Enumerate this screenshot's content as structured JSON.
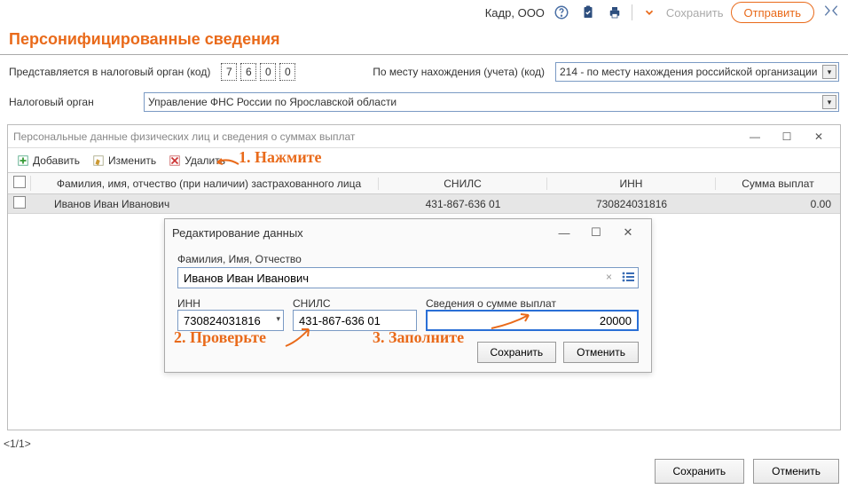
{
  "top": {
    "company": "Кадр, ООО",
    "save": "Сохранить",
    "send": "Отправить"
  },
  "title": "Персонифицированные сведения",
  "row1": {
    "label1": "Представляется в налоговый орган (код)",
    "digits": [
      "7",
      "6",
      "0",
      "0"
    ],
    "label2": "По месту нахождения (учета) (код)",
    "loc_value": "214 - по месту нахождения российской организации"
  },
  "row2": {
    "label": "Налоговый орган",
    "value": "Управление ФНС России по Ярославской области"
  },
  "inner": {
    "title": "Персональные данные физических лиц и сведения о суммах выплат",
    "toolbar": {
      "add": "Добавить",
      "edit": "Изменить",
      "delete": "Удалить"
    },
    "annot1": "1. Нажмите",
    "columns": {
      "fio": "Фамилия, имя, отчество (при наличии) застрахованного лица",
      "snils": "СНИЛС",
      "inn": "ИНН",
      "sum": "Сумма выплат"
    },
    "rows": [
      {
        "fio": "Иванов Иван Иванович",
        "snils": "431-867-636 01",
        "inn": "730824031816",
        "sum": "0.00"
      }
    ]
  },
  "dialog": {
    "title": "Редактирование данных",
    "fio_label": "Фамилия, Имя, Отчество",
    "fio_value": "Иванов Иван Иванович",
    "inn_label": "ИНН",
    "inn_value": "730824031816",
    "snils_label": "СНИЛС",
    "snils_value": "431-867-636 01",
    "sum_label": "Сведения о сумме выплат",
    "sum_value": "20000",
    "save": "Сохранить",
    "cancel": "Отменить"
  },
  "annot2": "2. Проверьте",
  "annot3": "3. Заполните",
  "pager": "<1/1>",
  "bottom": {
    "save": "Сохранить",
    "cancel": "Отменить"
  }
}
